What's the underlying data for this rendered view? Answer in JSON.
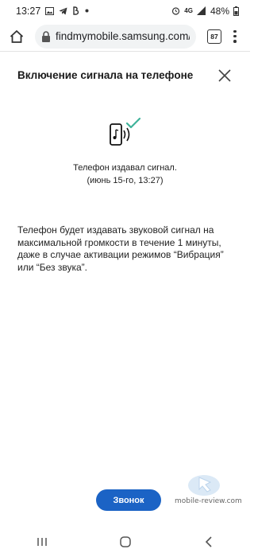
{
  "status_bar": {
    "time": "13:27",
    "network": "4G",
    "battery": "48%",
    "icons": [
      "image-icon",
      "telegram-icon",
      "vk-icon",
      "dot-icon"
    ]
  },
  "browser": {
    "url": "findmymobile.samsung.com/#",
    "tab_count": "87",
    "icons": [
      "home-icon",
      "lock-icon",
      "tabs-icon",
      "overflow-menu-icon"
    ]
  },
  "dialog": {
    "title": "Включение сигнала на телефоне",
    "status_line1": "Телефон издавал сигнал.",
    "status_line2": "(июнь 15-го, 13:27)",
    "description": "Телефон будет издавать звуковой сигнал на максимальной громкости в течение 1 минуты, даже в случае активации режимов “Вибрация” или “Без звука”.",
    "button_label": "Звонок",
    "accent_color": "#1b63c5",
    "check_color": "#3fb39a"
  },
  "watermark": {
    "text": "mobile-review.com"
  },
  "nav_bar": {
    "icons": [
      "recent-apps-icon",
      "home-nav-icon",
      "back-icon"
    ]
  }
}
